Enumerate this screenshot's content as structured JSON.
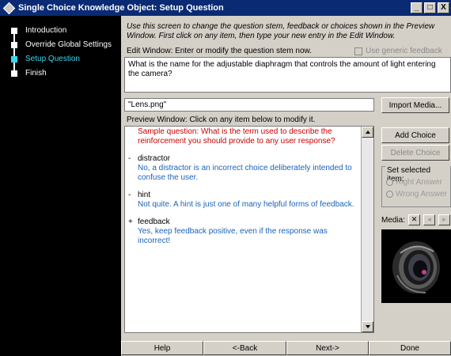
{
  "window": {
    "title": "Single Choice Knowledge Object: Setup Question",
    "minimize_glyph": "_",
    "maximize_glyph": "□",
    "close_glyph": "X"
  },
  "steps": [
    {
      "label": "Introduction"
    },
    {
      "label": "Override Global Settings"
    },
    {
      "label": "Setup Question"
    },
    {
      "label": "Finish"
    }
  ],
  "main": {
    "instructions": "Use this screen to change the question stem, feedback or choices shown in the Preview Window. First click on any item, then type your new entry in the Edit Window.",
    "edit_label": "Edit Window: Enter or modify the question stem now.",
    "generic_label": "Use generic feedback",
    "edit_text": "What is the name for the adjustable diaphragm that controls the amount of light entering the camera?",
    "media_file": "\"Lens.png\"",
    "import_label": "Import Media...",
    "preview_label": "Preview Window: Click on any item below to modify it.",
    "preview": {
      "sample_question": "Sample question: What is the term used to describe the reinforcement you should provide to any user response?",
      "items": [
        {
          "mark": "-",
          "label": "distractor",
          "feedback": "No, a distractor is an incorrect choice deliberately intended to confuse the user."
        },
        {
          "mark": "-",
          "label": "hint",
          "feedback": "Not quite. A hint is just one of many helpful forms of feedback."
        },
        {
          "mark": "+",
          "label": "feedback",
          "feedback": "Yes, keep feedback positive, even if the response was incorrect!"
        }
      ]
    },
    "add_choice": "Add Choice",
    "delete_choice": "Delete Choice",
    "set_item_label": "Set selected item:",
    "right_answer": "Right Answer",
    "wrong_answer": "Wrong Answer",
    "media_label": "Media:"
  },
  "nav": {
    "help": "Help",
    "back": "<-Back",
    "next": "Next->",
    "done": "Done"
  },
  "colors": {
    "titlebar": "#0a2a73",
    "active_step": "#38d6f0",
    "question_text": "#cc0000",
    "feedback_text": "#1a63b8"
  }
}
